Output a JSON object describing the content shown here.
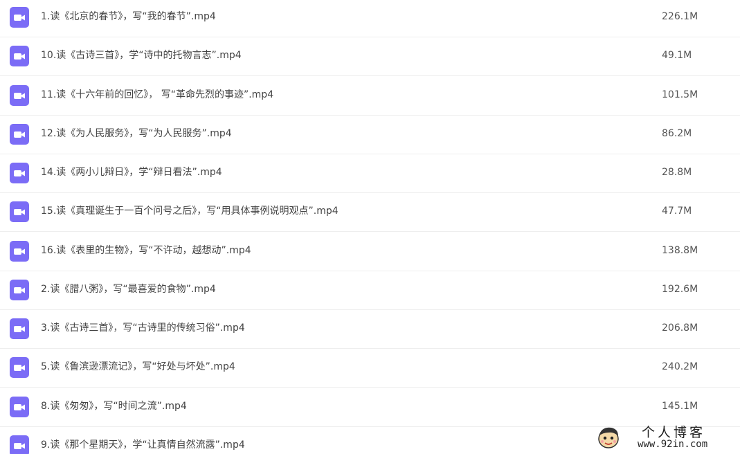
{
  "files": [
    {
      "name": "1.读《北京的春节》，写“我的春节”.mp4",
      "size": "226.1M",
      "icon": "video-file-icon"
    },
    {
      "name": "10.读《古诗三首》，学“诗中的托物言志”.mp4",
      "size": "49.1M",
      "icon": "video-file-icon"
    },
    {
      "name": "11.读《十六年前的回忆》， 写“革命先烈的事迹”.mp4",
      "size": "101.5M",
      "icon": "video-file-icon"
    },
    {
      "name": "12.读《为人民服务》，写“为人民服务”.mp4",
      "size": "86.2M",
      "icon": "video-file-icon"
    },
    {
      "name": "14.读《两小儿辩日》，学“辩日看法”.mp4",
      "size": "28.8M",
      "icon": "video-file-icon"
    },
    {
      "name": "15.读《真理诞生于一百个问号之后》，写“用具体事例说明观点”.mp4",
      "size": "47.7M",
      "icon": "video-file-icon"
    },
    {
      "name": "16.读《表里的生物》，写“不许动，越想动”.mp4",
      "size": "138.8M",
      "icon": "video-file-icon"
    },
    {
      "name": "2.读《腊八粥》，写“最喜爱的食物”.mp4",
      "size": "192.6M",
      "icon": "video-file-icon"
    },
    {
      "name": "3.读《古诗三首》，写“古诗里的传统习俗”.mp4",
      "size": "206.8M",
      "icon": "video-file-icon"
    },
    {
      "name": "5.读《鲁滨逊漂流记》，写“好处与坏处”.mp4",
      "size": "240.2M",
      "icon": "video-file-icon"
    },
    {
      "name": "8.读《匆匆》，写“时间之流”.mp4",
      "size": "145.1M",
      "icon": "video-file-icon"
    },
    {
      "name": "9.读《那个星期天》，学“让真情自然流露”.mp4",
      "size": "",
      "icon": "video-file-icon"
    }
  ],
  "watermark": {
    "title": "个人博客",
    "url": "www.92in.com"
  },
  "colors": {
    "icon_accent": "#7b6cf6",
    "divider": "#eeeeee",
    "text": "#444444"
  }
}
